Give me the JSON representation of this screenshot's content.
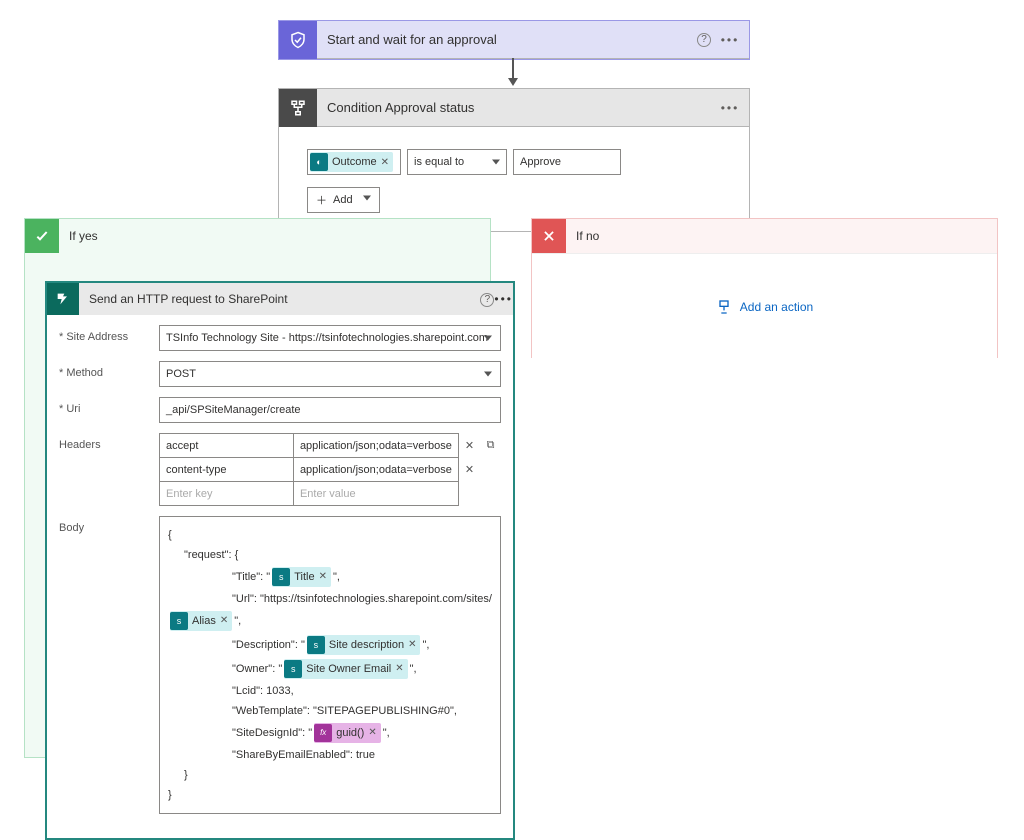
{
  "approval": {
    "title": "Start and wait for an approval"
  },
  "condition": {
    "title": "Condition Approval status",
    "outcome_token": "Outcome",
    "operator": "is equal to",
    "value": "Approve",
    "add_label": "Add"
  },
  "branches": {
    "yes": "If yes",
    "no": "If no",
    "add_action": "Add an action"
  },
  "http": {
    "title": "Send an HTTP request to SharePoint",
    "labels": {
      "site": "Site Address",
      "method": "Method",
      "uri": "Uri",
      "headers": "Headers",
      "body": "Body"
    },
    "site_address": "TSInfo Technology Site - https://tsinfotechnologies.sharepoint.com",
    "method": "POST",
    "uri": "_api/SPSiteManager/create",
    "headers": [
      {
        "key": "accept",
        "value": "application/json;odata=verbose"
      },
      {
        "key": "content-type",
        "value": "application/json;odata=verbose"
      }
    ],
    "headers_placeholder": {
      "key": "Enter key",
      "value": "Enter value"
    },
    "body_lines": {
      "open": "{",
      "request": "\"request\": {",
      "title_pre": "\"Title\": \"",
      "url": "\"Url\": \"https://tsinfotechnologies.sharepoint.com/sites/",
      "desc_pre": "\"Description\": \"",
      "owner_pre": "\"Owner\": \"",
      "lcid": "\"Lcid\": 1033,",
      "tmpl": "\"WebTemplate\": \"SITEPAGEPUBLISHING#0\",",
      "design_pre": "\"SiteDesignId\": \"",
      "share": "\"ShareByEmailEnabled\": true",
      "close_req": "}",
      "close": "}"
    },
    "tokens": {
      "title": "Title",
      "alias": "Alias",
      "site_desc": "Site description",
      "owner": "Site Owner Email",
      "guid": "guid()"
    },
    "suffix_dq_comma": "\","
  }
}
